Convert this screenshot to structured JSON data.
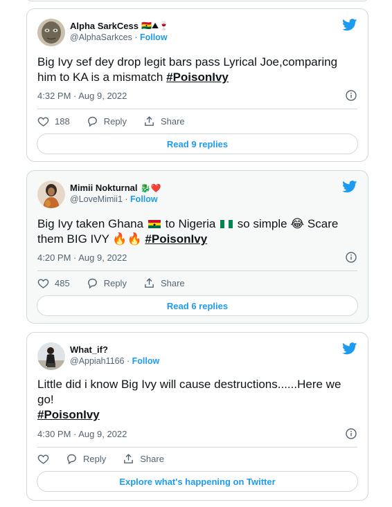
{
  "tweets": [
    {
      "name": "Alpha SarkCess",
      "name_emoji": "🇬🇭⛰🍷",
      "handle": "@AlphaSarkces",
      "separator": "·",
      "follow_label": "Follow",
      "text": "Big Ivy sef dey drop legit bars pass Lyrical Joe,comparing him to KA is a mismatch ",
      "hashtag": "#PoisonIvy",
      "timestamp": "4:32 PM · Aug 9, 2022",
      "like_count": "188",
      "reply_label": "Reply",
      "share_label": "Share",
      "button_label": "Read 9 replies"
    },
    {
      "name": "Mimii Nokturnal",
      "name_emoji": "🐉❤️",
      "handle": "@LoveMimii1",
      "separator": "·",
      "follow_label": "Follow",
      "text_a": "Big Ivy taken Ghana",
      "text_b": "to Nigeria",
      "text_c": "so simple 😂 Scare them BIG IVY 🔥🔥 ",
      "hashtag": "#PoisonIvy",
      "timestamp": "4:20 PM · Aug 9, 2022",
      "like_count": "485",
      "reply_label": "Reply",
      "share_label": "Share",
      "button_label": "Read 6 replies"
    },
    {
      "name": "What_if?",
      "handle": "@Appiah1166",
      "separator": "·",
      "follow_label": "Follow",
      "text": "Little did i know Big Ivy will cause destructions......Here we go!",
      "hashtag": "#PoisonIvy",
      "timestamp": "4:30 PM · Aug 9, 2022",
      "reply_label": "Reply",
      "share_label": "Share",
      "button_label": "Explore what's happening on Twitter"
    }
  ],
  "colors": {
    "accent": "#1d9bf0",
    "muted": "#536471",
    "border": "#cfd9de",
    "text": "#0f1419"
  },
  "icons": [
    "twitter-bird-icon",
    "info-icon",
    "heart-icon",
    "reply-icon",
    "share-icon"
  ]
}
